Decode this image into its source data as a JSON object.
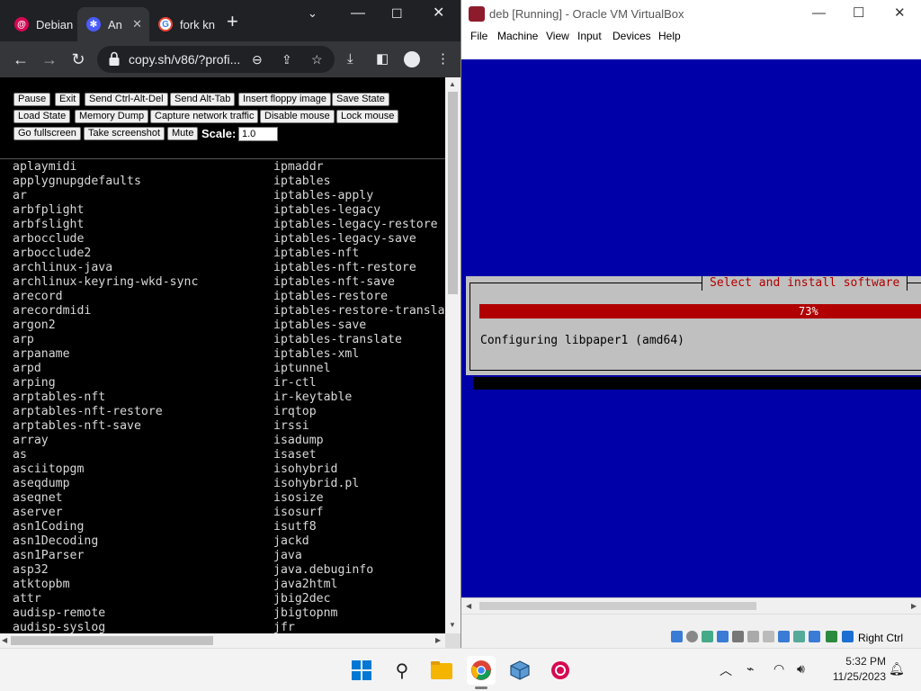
{
  "chrome": {
    "tabs": [
      {
        "label": "Debian",
        "favicon": "debian-icon",
        "active": false
      },
      {
        "label": "An",
        "favicon": "v86-icon",
        "active": true
      },
      {
        "label": "fork kn",
        "favicon": "google-icon",
        "active": false
      }
    ],
    "url": "copy.sh/v86/?profi...",
    "controls": {
      "pause": "Pause",
      "exit": "Exit",
      "ctrl_alt_del": "Send Ctrl-Alt-Del",
      "alt_tab": "Send Alt-Tab",
      "floppy": "Insert floppy image",
      "save_state": "Save State",
      "load_state": "Load State",
      "memory_dump": "Memory Dump",
      "capture": "Capture network traffic",
      "disable_mouse": "Disable mouse",
      "lock_mouse": "Lock mouse",
      "fullscreen": "Go fullscreen",
      "screenshot": "Take screenshot",
      "mute": "Mute",
      "scale_label": "Scale:",
      "scale_value": "1.0"
    },
    "terminal": {
      "col1": [
        "aplaymidi",
        "applygnupgdefaults",
        "ar",
        "arbfplight",
        "arbfslight",
        "arbocclude",
        "arbocclude2",
        "archlinux-java",
        "archlinux-keyring-wkd-sync",
        "arecord",
        "arecordmidi",
        "argon2",
        "arp",
        "arpaname",
        "arpd",
        "arping",
        "arptables-nft",
        "arptables-nft-restore",
        "arptables-nft-save",
        "array",
        "as",
        "asciitopgm",
        "aseqdump",
        "aseqnet",
        "aserver",
        "asn1Coding",
        "asn1Decoding",
        "asn1Parser",
        "asp32",
        "atktopbm",
        "attr",
        "audisp-remote",
        "audisp-syslog"
      ],
      "col2": [
        "ipmaddr",
        "iptables",
        "iptables-apply",
        "iptables-legacy",
        "iptables-legacy-restore",
        "iptables-legacy-save",
        "iptables-nft",
        "iptables-nft-restore",
        "iptables-nft-save",
        "iptables-restore",
        "iptables-restore-transla",
        "iptables-save",
        "iptables-translate",
        "iptables-xml",
        "iptunnel",
        "ir-ctl",
        "ir-keytable",
        "irqtop",
        "irssi",
        "isadump",
        "isaset",
        "isohybrid",
        "isohybrid.pl",
        "isosize",
        "isosurf",
        "isutf8",
        "jackd",
        "java",
        "java.debuginfo",
        "java2html",
        "jbig2dec",
        "jbigtopnm",
        "jfr"
      ]
    }
  },
  "vbox": {
    "title": "deb [Running] - Oracle VM VirtualBox",
    "menu": [
      "File",
      "Machine",
      "View",
      "Input",
      "Devices",
      "Help"
    ],
    "installer": {
      "dialog_title": "Select and install software",
      "progress_percent": 73,
      "progress_label": "73%",
      "status": "Configuring libpaper1 (amd64)"
    },
    "host_key": "Right Ctrl"
  },
  "taskbar": {
    "time": "5:32 PM",
    "date": "11/25/2023"
  },
  "colors": {
    "guest_blue": "#0000a8",
    "installer_red": "#b00000",
    "dialog_gray": "#c0c0c0",
    "chrome_dark": "#202124"
  }
}
